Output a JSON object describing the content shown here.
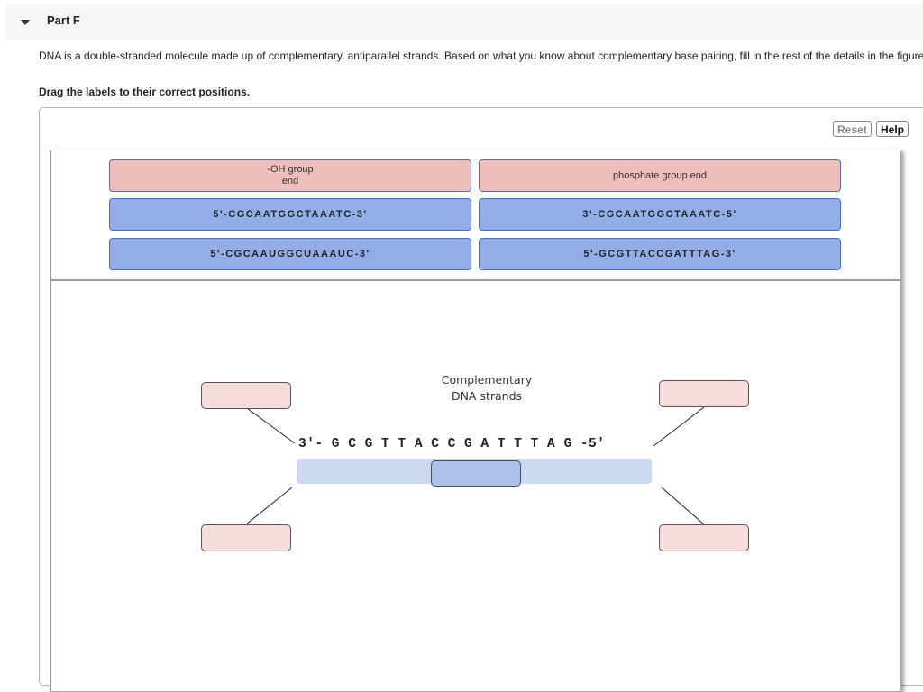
{
  "part": {
    "title": "Part F",
    "expanded": true
  },
  "prompt": "DNA is a double-stranded molecule made up of complementary, antiparallel strands. Based on what you know about complementary base pairing, fill in the rest of the details in the figure.",
  "instruction": "Drag the labels to their correct positions.",
  "toolbar": {
    "reset_label": "Reset",
    "help_label": "Help"
  },
  "label_bank": [
    {
      "text_line1": "-OH group",
      "text_line2": "end",
      "kind": "end-label"
    },
    {
      "text_line1": "phosphate group end",
      "text_line2": "",
      "kind": "end-label"
    },
    {
      "text_line1": "5'-CGCAATGGCTAAATC-3'",
      "text_line2": "",
      "kind": "strand-label"
    },
    {
      "text_line1": "3'-CGCAATGGCTAAATC-5'",
      "text_line2": "",
      "kind": "strand-label"
    },
    {
      "text_line1": "5'-CGCAAUGGCUAAAUC-3'",
      "text_line2": "",
      "kind": "strand-label"
    },
    {
      "text_line1": "5'-GCGTTACCGATTTAG-3'",
      "text_line2": "",
      "kind": "strand-label"
    }
  ],
  "figure": {
    "title_line1": "Complementary",
    "title_line2": "DNA strands",
    "given_strand": "3'- G C G T T A C C G A T T T A G -5'",
    "drop_targets": [
      "top-left",
      "bottom-left",
      "top-right",
      "bottom-right",
      "center-strand"
    ]
  },
  "colors": {
    "end_label_bg": "#eebebb",
    "strand_label_bg": "#93aee6",
    "drop_target_bg": "#f4dcdb",
    "strand_bar_bg": "#c9d9ee",
    "center_drop_bg": "#adc1ea"
  }
}
